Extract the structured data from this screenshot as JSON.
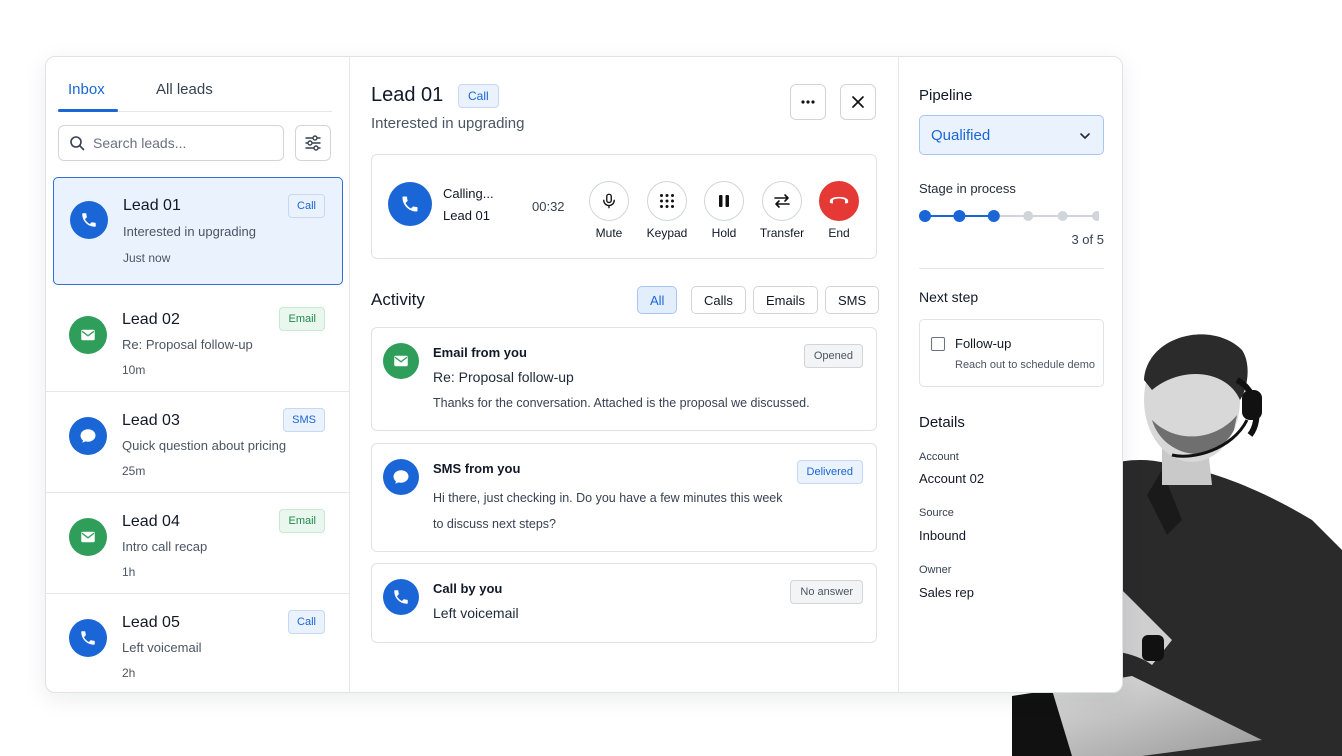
{
  "tabs": {
    "inbox": "Inbox",
    "all_leads": "All leads"
  },
  "search": {
    "placeholder": "Search leads..."
  },
  "leads": [
    {
      "name": "Lead 01",
      "subject": "Interested in upgrading",
      "time": "Just now",
      "badge": "Call",
      "icon": "phone-icon"
    },
    {
      "name": "Lead 02",
      "subject": "Re: Proposal follow-up",
      "time": "10m",
      "badge": "Email",
      "icon": "mail-icon"
    },
    {
      "name": "Lead 03",
      "subject": "Quick question about pricing",
      "time": "25m",
      "badge": "SMS",
      "icon": "chat-bubble-icon"
    },
    {
      "name": "Lead 04",
      "subject": "Intro call recap",
      "time": "1h",
      "badge": "Email",
      "icon": "mail-icon"
    },
    {
      "name": "Lead 05",
      "subject": "Left voicemail",
      "time": "2h",
      "badge": "Call",
      "icon": "phone-icon"
    }
  ],
  "detail": {
    "title": "Lead 01",
    "badge": "Call",
    "subtitle": "Interested in upgrading"
  },
  "call": {
    "status": "Calling...",
    "lead": "Lead 01",
    "timer": "00:32",
    "controls": {
      "mute": "Mute",
      "keypad": "Keypad",
      "hold": "Hold",
      "transfer": "Transfer",
      "end": "End"
    }
  },
  "activity": {
    "title": "Activity",
    "filters": [
      "All",
      "Calls",
      "Emails",
      "SMS"
    ],
    "items": [
      {
        "title": "Email from you",
        "subject": "Re: Proposal follow-up",
        "body": "Thanks for the conversation. Attached is the proposal we discussed.",
        "status": "Opened"
      },
      {
        "title": "SMS from you",
        "body": "Hi there, just checking in. Do you have a few minutes this week to discuss next steps?",
        "status": "Delivered"
      },
      {
        "title": "Call by you",
        "subject": "Left voicemail",
        "status": "No answer"
      }
    ]
  },
  "pipeline": {
    "title": "Pipeline",
    "selected": "Qualified",
    "stage_label": "Stage in process",
    "stage_current": 3,
    "stage_total": 6,
    "stage_count_text": "3 of 5"
  },
  "next_step": {
    "title": "Next step",
    "task": "Follow-up",
    "task_detail": "Reach out to schedule demo"
  },
  "details": {
    "title": "Details",
    "account_label": "Account",
    "account": "Account 02",
    "source_label": "Source",
    "source": "Inbound",
    "owner_label": "Owner",
    "owner": "Sales rep"
  },
  "colors": {
    "accent": "#1a66d6",
    "green": "#2e9e5a",
    "end_red": "#e53935"
  }
}
